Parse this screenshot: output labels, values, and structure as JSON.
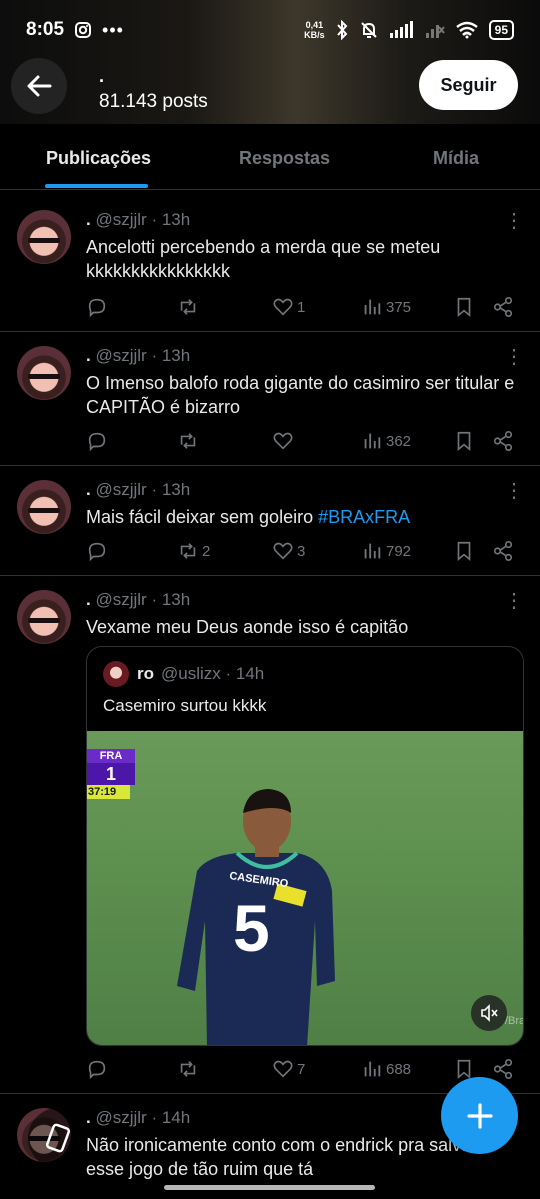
{
  "status_bar": {
    "time": "8:05",
    "net_speed_value": "0,41",
    "net_speed_unit": "KB/s",
    "battery": "95"
  },
  "header": {
    "name": ".",
    "post_count": "81.143 posts",
    "follow_label": "Seguir"
  },
  "tabs": [
    "Publicações",
    "Respostas",
    "Mídia"
  ],
  "posts": [
    {
      "name": ".",
      "handle_time": "@szjjlr · 13h",
      "text": "Ancelotti percebendo a merda que se meteu kkkkkkkkkkkkkkkk",
      "replies": "",
      "reposts": "",
      "likes": "1",
      "views": "375"
    },
    {
      "name": ".",
      "handle_time": "@szjjlr · 13h",
      "text": "O Imenso balofo roda gigante do casimiro ser titular e CAPITÃO é bizarro",
      "replies": "",
      "reposts": "",
      "likes": "",
      "views": "362"
    },
    {
      "name": ".",
      "handle_time": "@szjjlr · 13h",
      "text": "Mais fácil deixar sem goleiro",
      "hashtag": "#BRAxFRA",
      "replies": "",
      "reposts": "2",
      "likes": "3",
      "views": "792"
    },
    {
      "name": ".",
      "handle_time": "@szjjlr · 13h",
      "text": "Vexame meu Deus aonde isso é capitão",
      "replies": "",
      "reposts": "",
      "likes": "7",
      "views": "688",
      "quote": {
        "name": "ro",
        "handle_time": "@uslizx · 14h",
        "text": "Casemiro surtou kkkk",
        "scoreboard": {
          "team": "FRA",
          "score": "1",
          "clock": "37:19"
        },
        "jersey_name": "CASEMIRO",
        "jersey_number": "5",
        "watermark": "/Bra"
      }
    },
    {
      "name": ".",
      "handle_time": "@szjjlr · 14h",
      "text": "Não ironicamente conto com o endrick pra salvar esse jogo de tão ruim que tá"
    }
  ],
  "colors": {
    "accent": "#1d9bf0",
    "muted": "#71767b",
    "divider": "#2f3336"
  }
}
